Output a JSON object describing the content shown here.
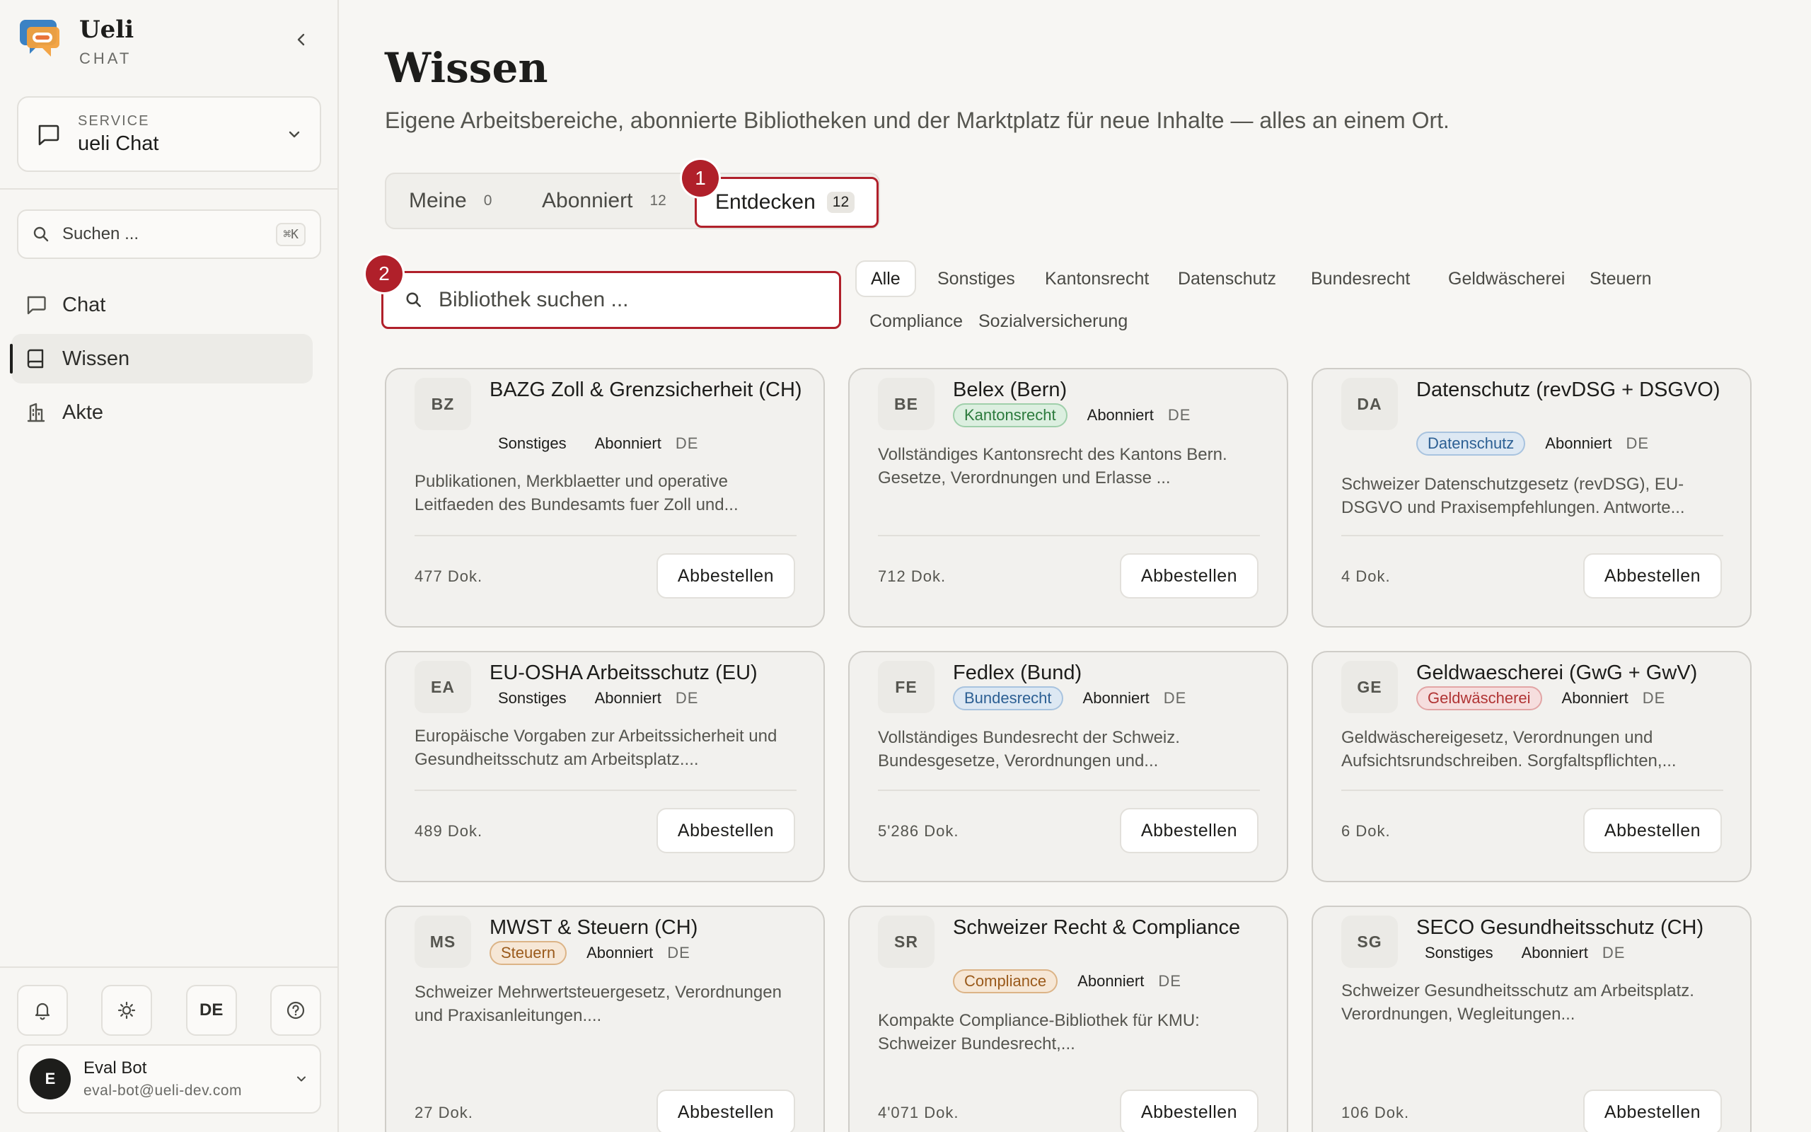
{
  "brand": {
    "name": "Ueli",
    "subtitle": "CHAT"
  },
  "service": {
    "label": "SERVICE",
    "value": "ueli Chat"
  },
  "sidebar_search": {
    "placeholder": "Suchen ...",
    "shortcut": "⌘K"
  },
  "nav": [
    {
      "label": "Chat",
      "icon": "chat-bubble-icon"
    },
    {
      "label": "Wissen",
      "icon": "book-icon",
      "active": true
    },
    {
      "label": "Akte",
      "icon": "building-icon"
    }
  ],
  "tools": {
    "language": "DE"
  },
  "user": {
    "initial": "E",
    "name": "Eval Bot",
    "email": "eval-bot@ueli-dev.com"
  },
  "page": {
    "title": "Wissen",
    "subtitle": "Eigene Arbeitsbereiche, abonnierte Bibliotheken und der Marktplatz für neue Inhalte — alles an einem Ort."
  },
  "tabs": [
    {
      "label": "Meine",
      "count": "0"
    },
    {
      "label": "Abonniert",
      "count": "12"
    },
    {
      "label": "Entdecken",
      "count": "12",
      "active": true
    }
  ],
  "markers": {
    "tab": "1",
    "search": "2"
  },
  "library_search": {
    "placeholder": "Bibliothek suchen ..."
  },
  "filters": [
    "Alle",
    "Sonstiges",
    "Kantonsrecht",
    "Datenschutz",
    "Bundesrecht",
    "Geldwäscherei",
    "Steuern",
    "Compliance",
    "Sozialversicherung"
  ],
  "colors": {
    "accent_red": "#b0202a",
    "kantonsrecht": {
      "bg": "#dcefe0",
      "border": "#9fcfaa",
      "text": "#2b7a3c"
    },
    "datenschutz": {
      "bg": "#dde8f3",
      "border": "#a8c3df",
      "text": "#2c5f93"
    },
    "bundesrecht": {
      "bg": "#dde8f3",
      "border": "#a8c3df",
      "text": "#2c5f93"
    },
    "geldwaescherei": {
      "bg": "#f6dede",
      "border": "#e2a5a5",
      "text": "#b03434"
    },
    "steuern": {
      "bg": "#f6e7d6",
      "border": "#dcb487",
      "text": "#9a5a1b"
    },
    "compliance": {
      "bg": "#f6e7d6",
      "border": "#dcb487",
      "text": "#9a5a1b"
    }
  },
  "cards": [
    {
      "abbr": "BZ",
      "title": "BAZG Zoll & Grenzsicherheit (CH)",
      "category": "Sonstiges",
      "status": "Abonniert",
      "lang": "DE",
      "description": "Publikationen, Merkblaetter und operative Leitfaeden des Bundesamts fuer Zoll und...",
      "docs": "477 Dok.",
      "action": "Abbestellen"
    },
    {
      "abbr": "BE",
      "title": "Belex (Bern)",
      "category": "Kantonsrecht",
      "status": "Abonniert",
      "lang": "DE",
      "description": "Vollständiges Kantonsrecht des Kantons Bern. Gesetze, Verordnungen und Erlasse ...",
      "docs": "712 Dok.",
      "action": "Abbestellen"
    },
    {
      "abbr": "DA",
      "title": "Datenschutz (revDSG + DSGVO)",
      "category": "Datenschutz",
      "status": "Abonniert",
      "lang": "DE",
      "description": "Schweizer Datenschutzgesetz (revDSG), EU-DSGVO und Praxisempfehlungen. Antworte...",
      "docs": "4 Dok.",
      "action": "Abbestellen"
    },
    {
      "abbr": "EA",
      "title": "EU-OSHA Arbeitsschutz (EU)",
      "category": "Sonstiges",
      "status": "Abonniert",
      "lang": "DE",
      "description": "Europäische Vorgaben zur Arbeitssicherheit und Gesundheitsschutz am Arbeitsplatz....",
      "docs": "489 Dok.",
      "action": "Abbestellen"
    },
    {
      "abbr": "FE",
      "title": "Fedlex (Bund)",
      "category": "Bundesrecht",
      "status": "Abonniert",
      "lang": "DE",
      "description": "Vollständiges Bundesrecht der Schweiz. Bundesgesetze, Verordnungen und...",
      "docs": "5'286 Dok.",
      "action": "Abbestellen"
    },
    {
      "abbr": "GE",
      "title": "Geldwaescherei (GwG + GwV)",
      "category": "Geldwäscherei",
      "status": "Abonniert",
      "lang": "DE",
      "description": "Geldwäschereigesetz, Verordnungen und Aufsichtsrundschreiben. Sorgfaltspflichten,...",
      "docs": "6 Dok.",
      "action": "Abbestellen"
    },
    {
      "abbr": "MS",
      "title": "MWST & Steuern (CH)",
      "category": "Steuern",
      "status": "Abonniert",
      "lang": "DE",
      "description": "Schweizer Mehrwertsteuergesetz, Verordnungen und Praxisanleitungen....",
      "docs": "27 Dok.",
      "action": "Abbestellen"
    },
    {
      "abbr": "SR",
      "title": "Schweizer Recht & Compliance",
      "category": "Compliance",
      "status": "Abonniert",
      "lang": "DE",
      "description": "Kompakte Compliance-Bibliothek für KMU: Schweizer Bundesrecht,...",
      "docs": "4'071 Dok.",
      "action": "Abbestellen"
    },
    {
      "abbr": "SG",
      "title": "SECO Gesundheitsschutz (CH)",
      "category": "Sonstiges",
      "status": "Abonniert",
      "lang": "DE",
      "description": "Schweizer Gesundheitsschutz am Arbeitsplatz. Verordnungen, Wegleitungen...",
      "docs": "106 Dok.",
      "action": "Abbestellen"
    }
  ]
}
